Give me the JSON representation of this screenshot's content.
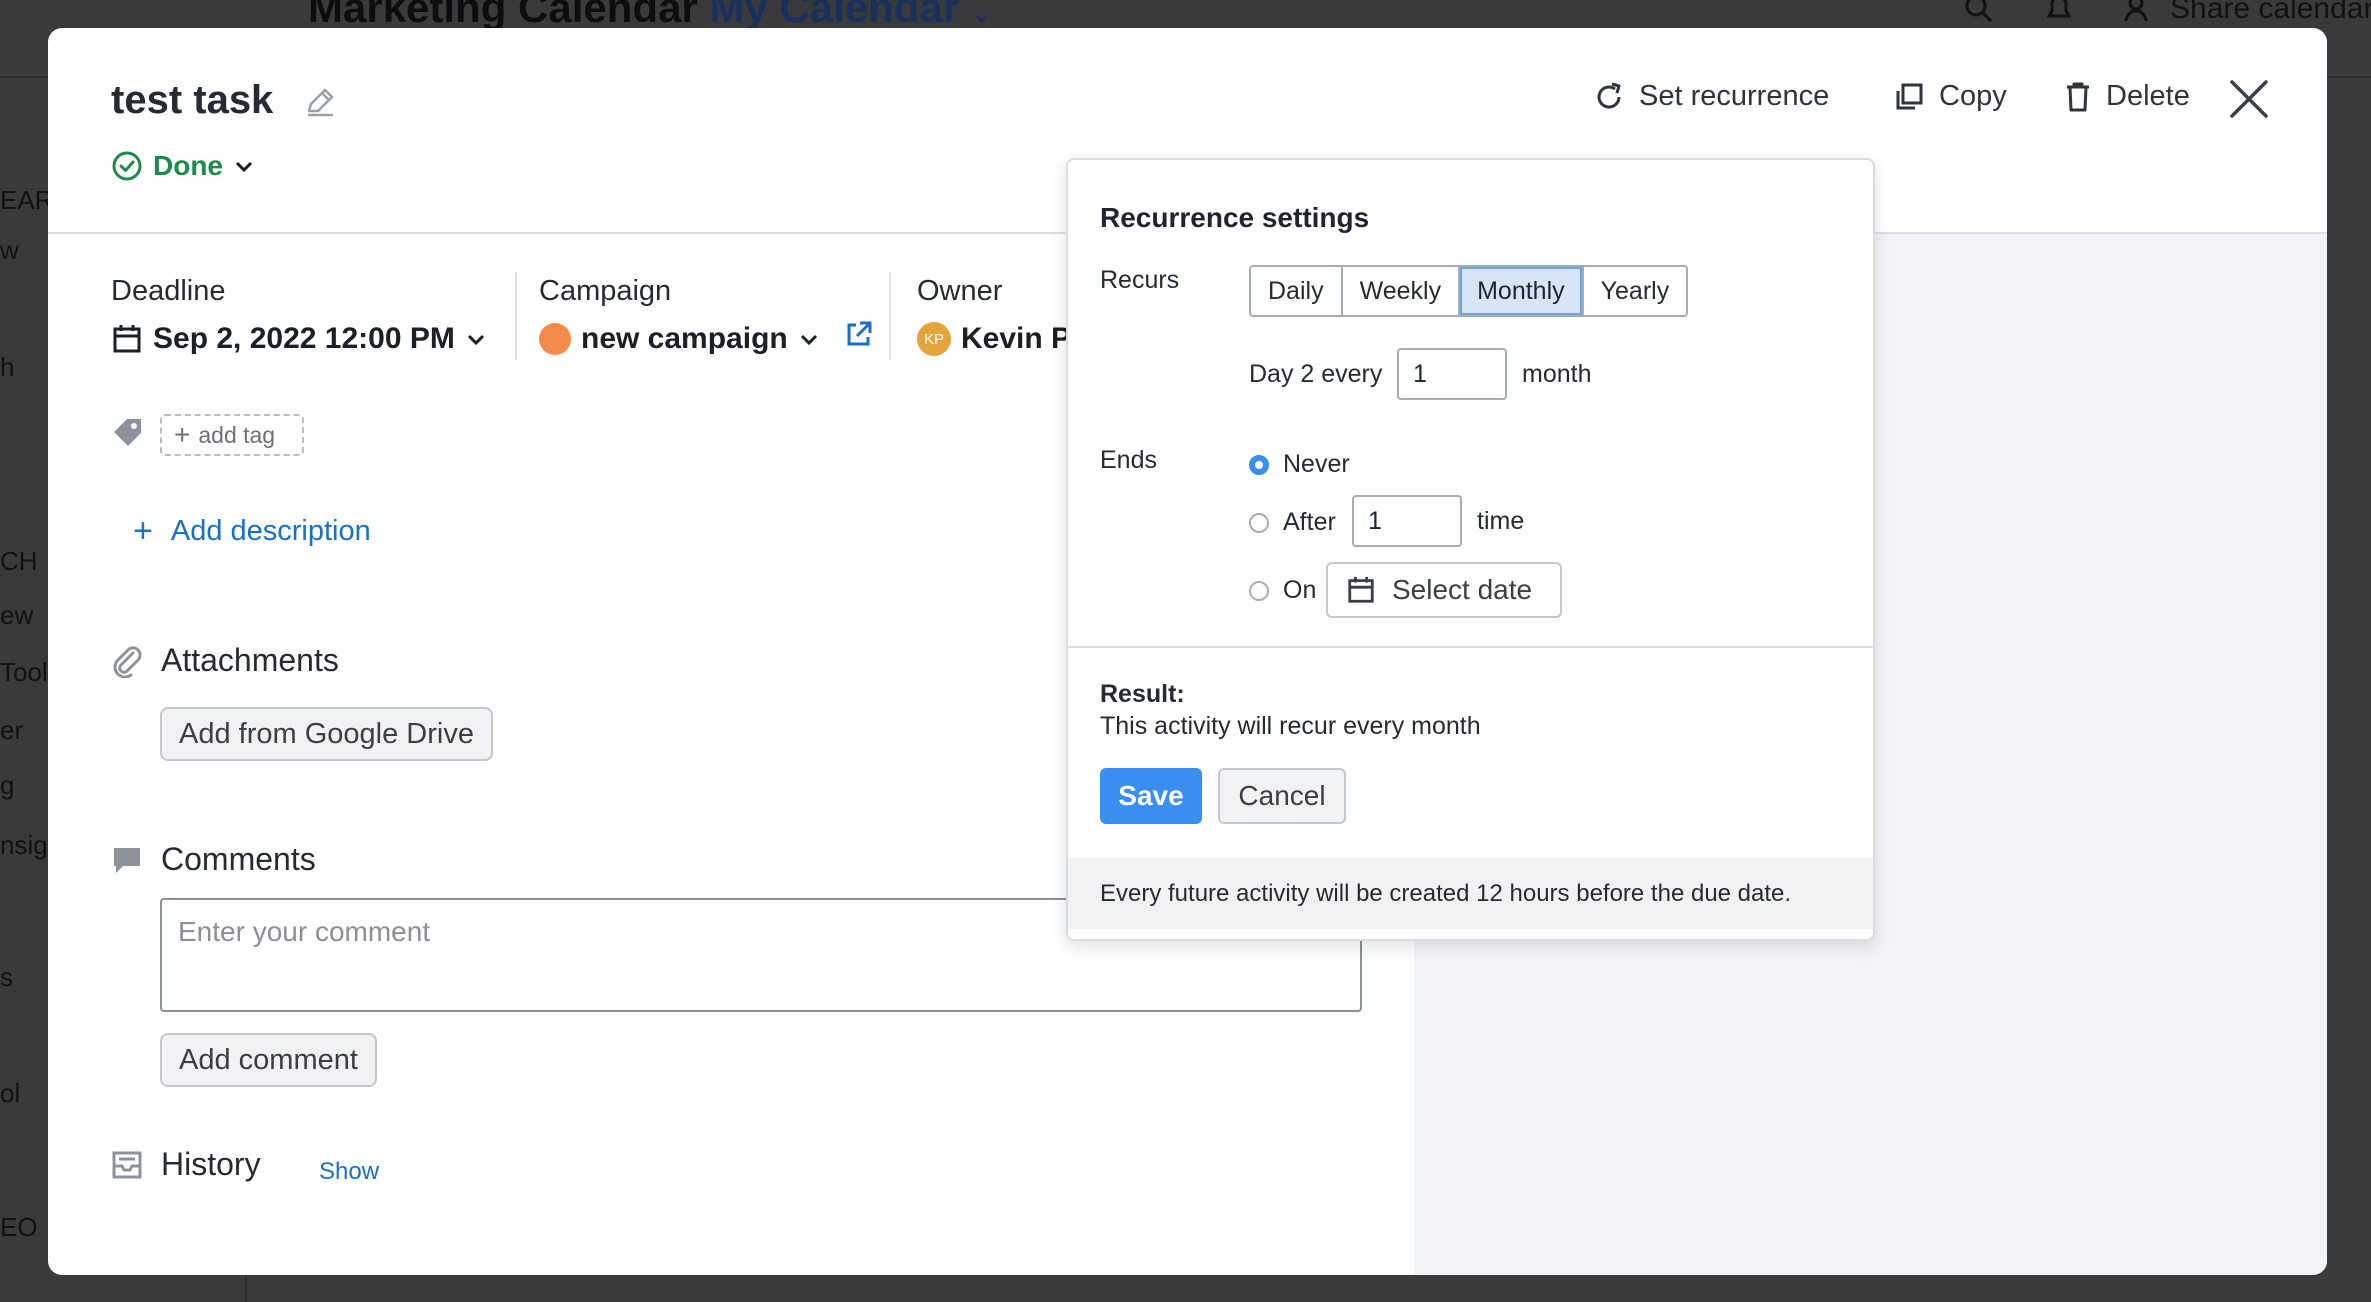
{
  "background": {
    "title_main": "Marketing Calendar",
    "title_calendar": "My Calendar",
    "share_label": "Share calendar",
    "sidebar_fragments": [
      "EARC",
      "w",
      "h",
      "CH",
      "ew",
      "Tool",
      "er",
      "g",
      "nsig",
      "s",
      "ol",
      "EO"
    ]
  },
  "task": {
    "title": "test task",
    "status": "Done",
    "status_color": "#1f8a4c"
  },
  "actions": {
    "set_recurrence": "Set recurrence",
    "copy": "Copy",
    "delete": "Delete"
  },
  "fields": {
    "deadline_label": "Deadline",
    "deadline_value": "Sep 2, 2022 12:00 PM",
    "campaign_label": "Campaign",
    "campaign_value": "new campaign",
    "campaign_color": "#f28c4b",
    "owner_label": "Owner",
    "owner_initials": "KP",
    "owner_name": "Kevin Pe"
  },
  "tags": {
    "add_tag": "add tag"
  },
  "description": {
    "add_label": "Add description"
  },
  "attachments": {
    "title": "Attachments",
    "google_drive_button": "Add from Google Drive"
  },
  "comments": {
    "title": "Comments",
    "placeholder": "Enter your comment",
    "value": "",
    "add_button": "Add comment"
  },
  "history": {
    "title": "History",
    "show_link": "Show"
  },
  "recurrence": {
    "title": "Recurrence settings",
    "recurs_label": "Recurs",
    "options": [
      "Daily",
      "Weekly",
      "Monthly",
      "Yearly"
    ],
    "selected": "Monthly",
    "day_prefix": "Day 2 every",
    "interval_value": "1",
    "interval_unit": "month",
    "ends_label": "Ends",
    "ends_selected": "Never",
    "end_never": "Never",
    "end_after": "After",
    "after_value": "1",
    "after_unit": "time",
    "end_on": "On",
    "select_date": "Select date",
    "result_label": "Result:",
    "result_text": "This activity will recur every month",
    "save": "Save",
    "cancel": "Cancel",
    "footer_note": "Every future activity will be created 12 hours before the due date.",
    "accent_color": "#3a8ef0"
  }
}
